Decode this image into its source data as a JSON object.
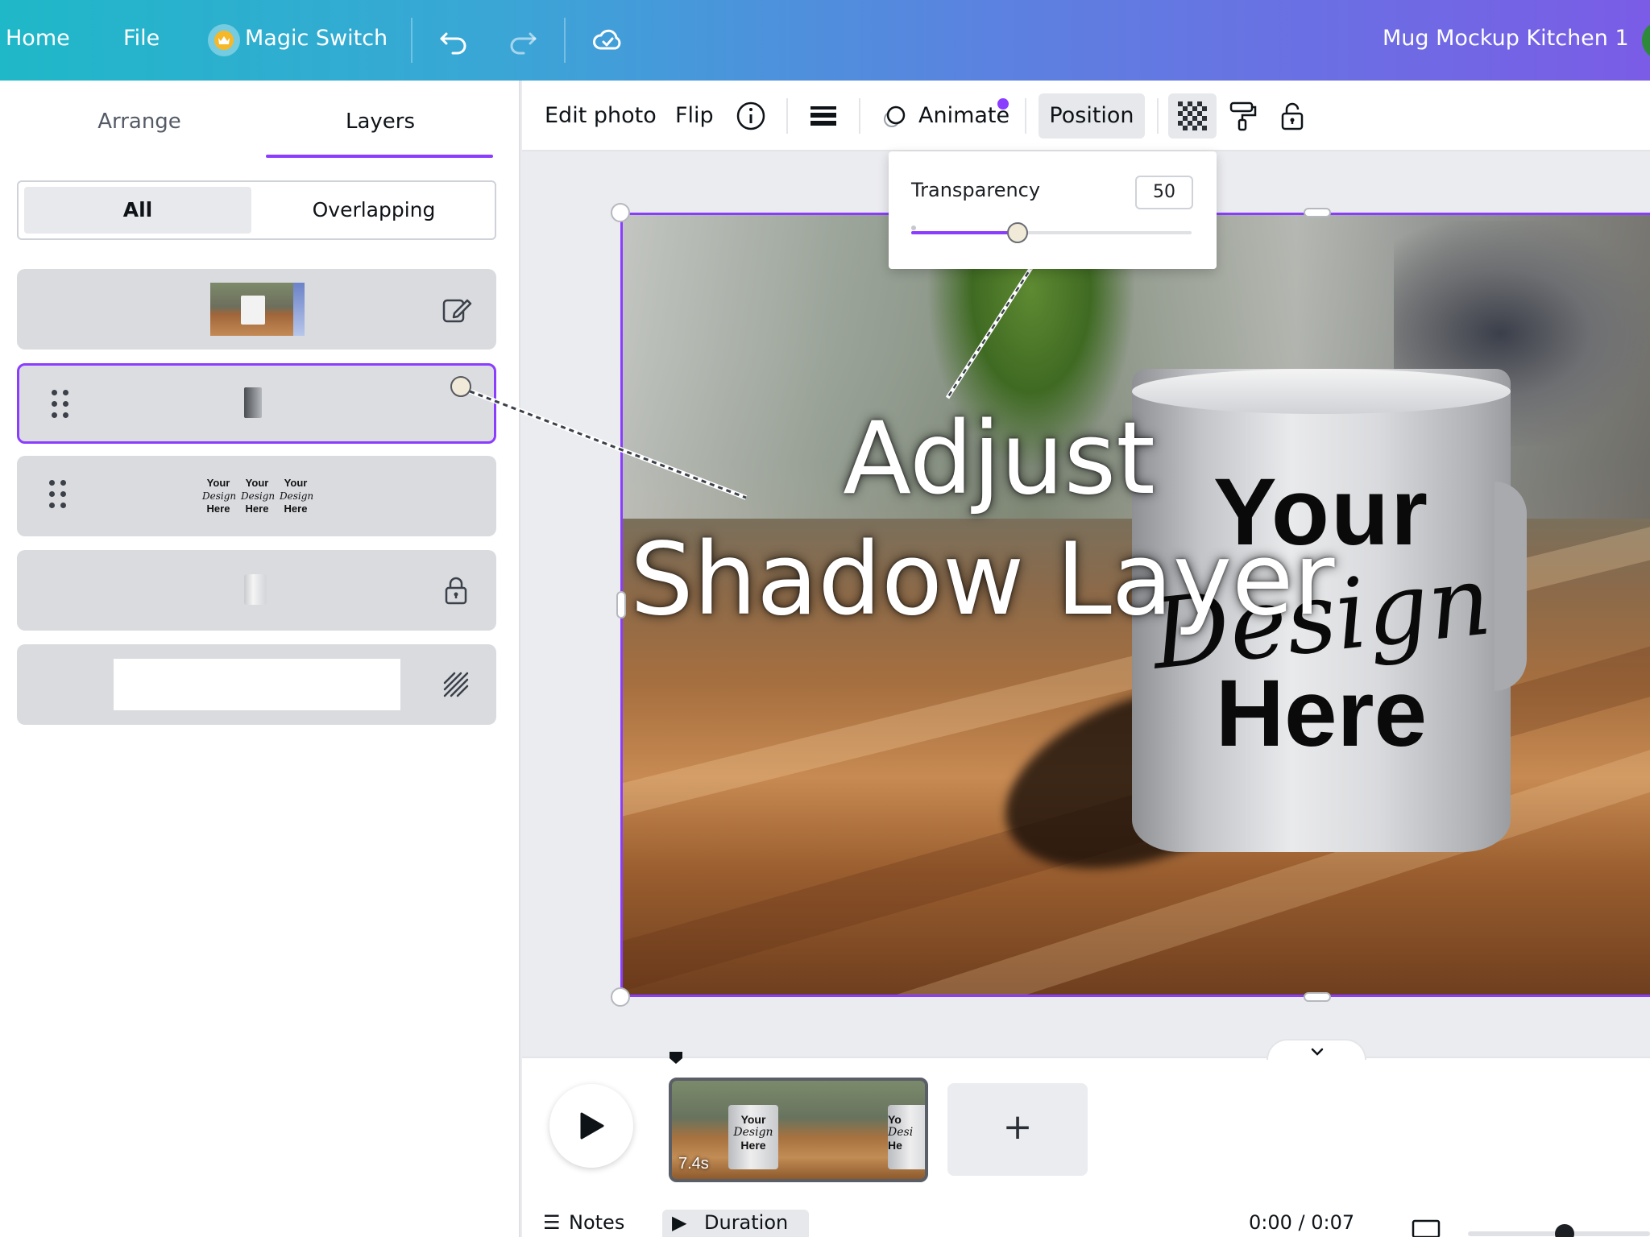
{
  "topbar": {
    "home": "Home",
    "file": "File",
    "magic_switch": "Magic Switch",
    "doc_title": "Mug Mockup Kitchen 1"
  },
  "left_panel": {
    "tabs": [
      {
        "label": "Arrange",
        "active": false
      },
      {
        "label": "Layers",
        "active": true
      }
    ],
    "filter": {
      "all": "All",
      "overlapping": "Overlapping",
      "selected": "All"
    },
    "layers": [
      {
        "kind": "photo",
        "icon": "edit-icon",
        "selected": false
      },
      {
        "kind": "shadow",
        "icon": "drag-handle-icon",
        "selected": true
      },
      {
        "kind": "text",
        "icon": "drag-handle-icon",
        "selected": false,
        "words": [
          "Your",
          "Design",
          "Here"
        ]
      },
      {
        "kind": "mug",
        "icon": "lock-icon",
        "selected": false
      },
      {
        "kind": "background",
        "icon": "hatch-icon",
        "selected": false
      }
    ]
  },
  "toolbar": {
    "edit_photo": "Edit photo",
    "flip": "Flip",
    "animate": "Animate",
    "position": "Position"
  },
  "transparency": {
    "label": "Transparency",
    "value": "50",
    "fraction": 0.5
  },
  "canvas": {
    "overlay_line1": "Adjust",
    "overlay_line2": "Shadow Layer",
    "mug_word1": "Your",
    "mug_word2": "Design",
    "mug_word3": "Here"
  },
  "timeline": {
    "clip_duration": "7.4s",
    "clip_text": [
      "Your",
      "Design",
      "Here"
    ],
    "clip_text_partial": [
      "Yo",
      "Desi",
      "He"
    ],
    "add_label": "+",
    "notes": "Notes",
    "duration": "Duration",
    "time": "0:00 / 0:07"
  },
  "colors": {
    "accent": "#8b3dff",
    "topbar_start": "#1fb8c8",
    "topbar_end": "#7a5ce6"
  }
}
